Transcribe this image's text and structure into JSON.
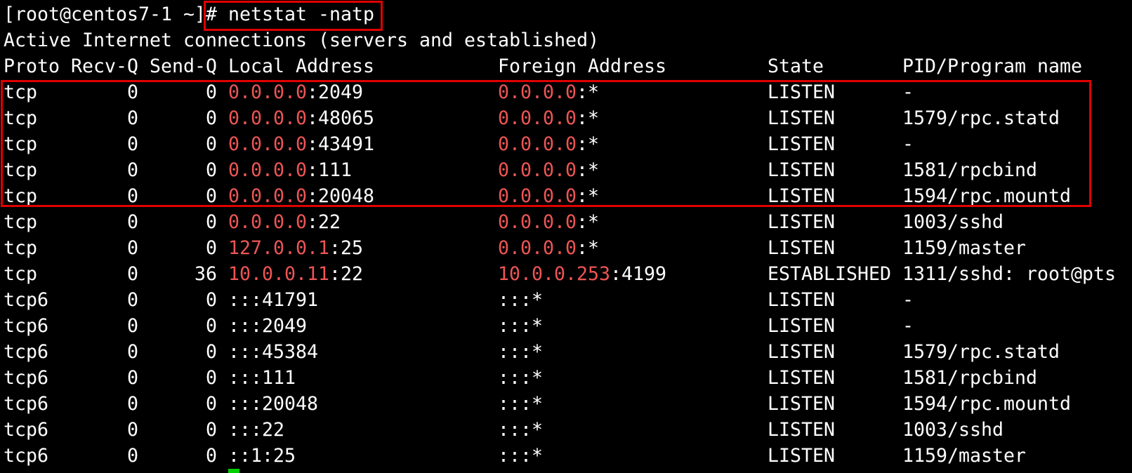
{
  "colors": {
    "background": "#000000",
    "text": "#ffffff",
    "ip_highlight": "#ee5555",
    "annotation_box": "#e00000",
    "cursor": "#00d000"
  },
  "prompt": {
    "text": "[root@centos7-1 ~]#",
    "command": "netstat -natp"
  },
  "output": {
    "title": "Active Internet connections (servers and established)"
  },
  "table": {
    "columns": [
      "Proto",
      "Recv-Q",
      "Send-Q",
      "Local Address",
      "Foreign Address",
      "State",
      "PID/Program name"
    ],
    "rows": [
      {
        "proto": "tcp",
        "recv_q": 0,
        "send_q": 0,
        "local_address": "0.0.0.0:2049",
        "foreign_address": "0.0.0.0:*",
        "state": "LISTEN",
        "pid_program": "-"
      },
      {
        "proto": "tcp",
        "recv_q": 0,
        "send_q": 0,
        "local_address": "0.0.0.0:48065",
        "foreign_address": "0.0.0.0:*",
        "state": "LISTEN",
        "pid_program": "1579/rpc.statd"
      },
      {
        "proto": "tcp",
        "recv_q": 0,
        "send_q": 0,
        "local_address": "0.0.0.0:43491",
        "foreign_address": "0.0.0.0:*",
        "state": "LISTEN",
        "pid_program": "-"
      },
      {
        "proto": "tcp",
        "recv_q": 0,
        "send_q": 0,
        "local_address": "0.0.0.0:111",
        "foreign_address": "0.0.0.0:*",
        "state": "LISTEN",
        "pid_program": "1581/rpcbind"
      },
      {
        "proto": "tcp",
        "recv_q": 0,
        "send_q": 0,
        "local_address": "0.0.0.0:20048",
        "foreign_address": "0.0.0.0:*",
        "state": "LISTEN",
        "pid_program": "1594/rpc.mountd"
      },
      {
        "proto": "tcp",
        "recv_q": 0,
        "send_q": 0,
        "local_address": "0.0.0.0:22",
        "foreign_address": "0.0.0.0:*",
        "state": "LISTEN",
        "pid_program": "1003/sshd"
      },
      {
        "proto": "tcp",
        "recv_q": 0,
        "send_q": 0,
        "local_address": "127.0.0.1:25",
        "foreign_address": "0.0.0.0:*",
        "state": "LISTEN",
        "pid_program": "1159/master"
      },
      {
        "proto": "tcp",
        "recv_q": 0,
        "send_q": 36,
        "local_address": "10.0.0.11:22",
        "foreign_address": "10.0.0.253:4199",
        "state": "ESTABLISHED",
        "pid_program": "1311/sshd: root@pts"
      },
      {
        "proto": "tcp6",
        "recv_q": 0,
        "send_q": 0,
        "local_address": ":::41791",
        "foreign_address": ":::*",
        "state": "LISTEN",
        "pid_program": "-"
      },
      {
        "proto": "tcp6",
        "recv_q": 0,
        "send_q": 0,
        "local_address": ":::2049",
        "foreign_address": ":::*",
        "state": "LISTEN",
        "pid_program": "-"
      },
      {
        "proto": "tcp6",
        "recv_q": 0,
        "send_q": 0,
        "local_address": ":::45384",
        "foreign_address": ":::*",
        "state": "LISTEN",
        "pid_program": "1579/rpc.statd"
      },
      {
        "proto": "tcp6",
        "recv_q": 0,
        "send_q": 0,
        "local_address": ":::111",
        "foreign_address": ":::*",
        "state": "LISTEN",
        "pid_program": "1581/rpcbind"
      },
      {
        "proto": "tcp6",
        "recv_q": 0,
        "send_q": 0,
        "local_address": ":::20048",
        "foreign_address": ":::*",
        "state": "LISTEN",
        "pid_program": "1594/rpc.mountd"
      },
      {
        "proto": "tcp6",
        "recv_q": 0,
        "send_q": 0,
        "local_address": ":::22",
        "foreign_address": ":::*",
        "state": "LISTEN",
        "pid_program": "1003/sshd"
      },
      {
        "proto": "tcp6",
        "recv_q": 0,
        "send_q": 0,
        "local_address": "::1:25",
        "foreign_address": ":::*",
        "state": "LISTEN",
        "pid_program": "1159/master"
      }
    ]
  }
}
